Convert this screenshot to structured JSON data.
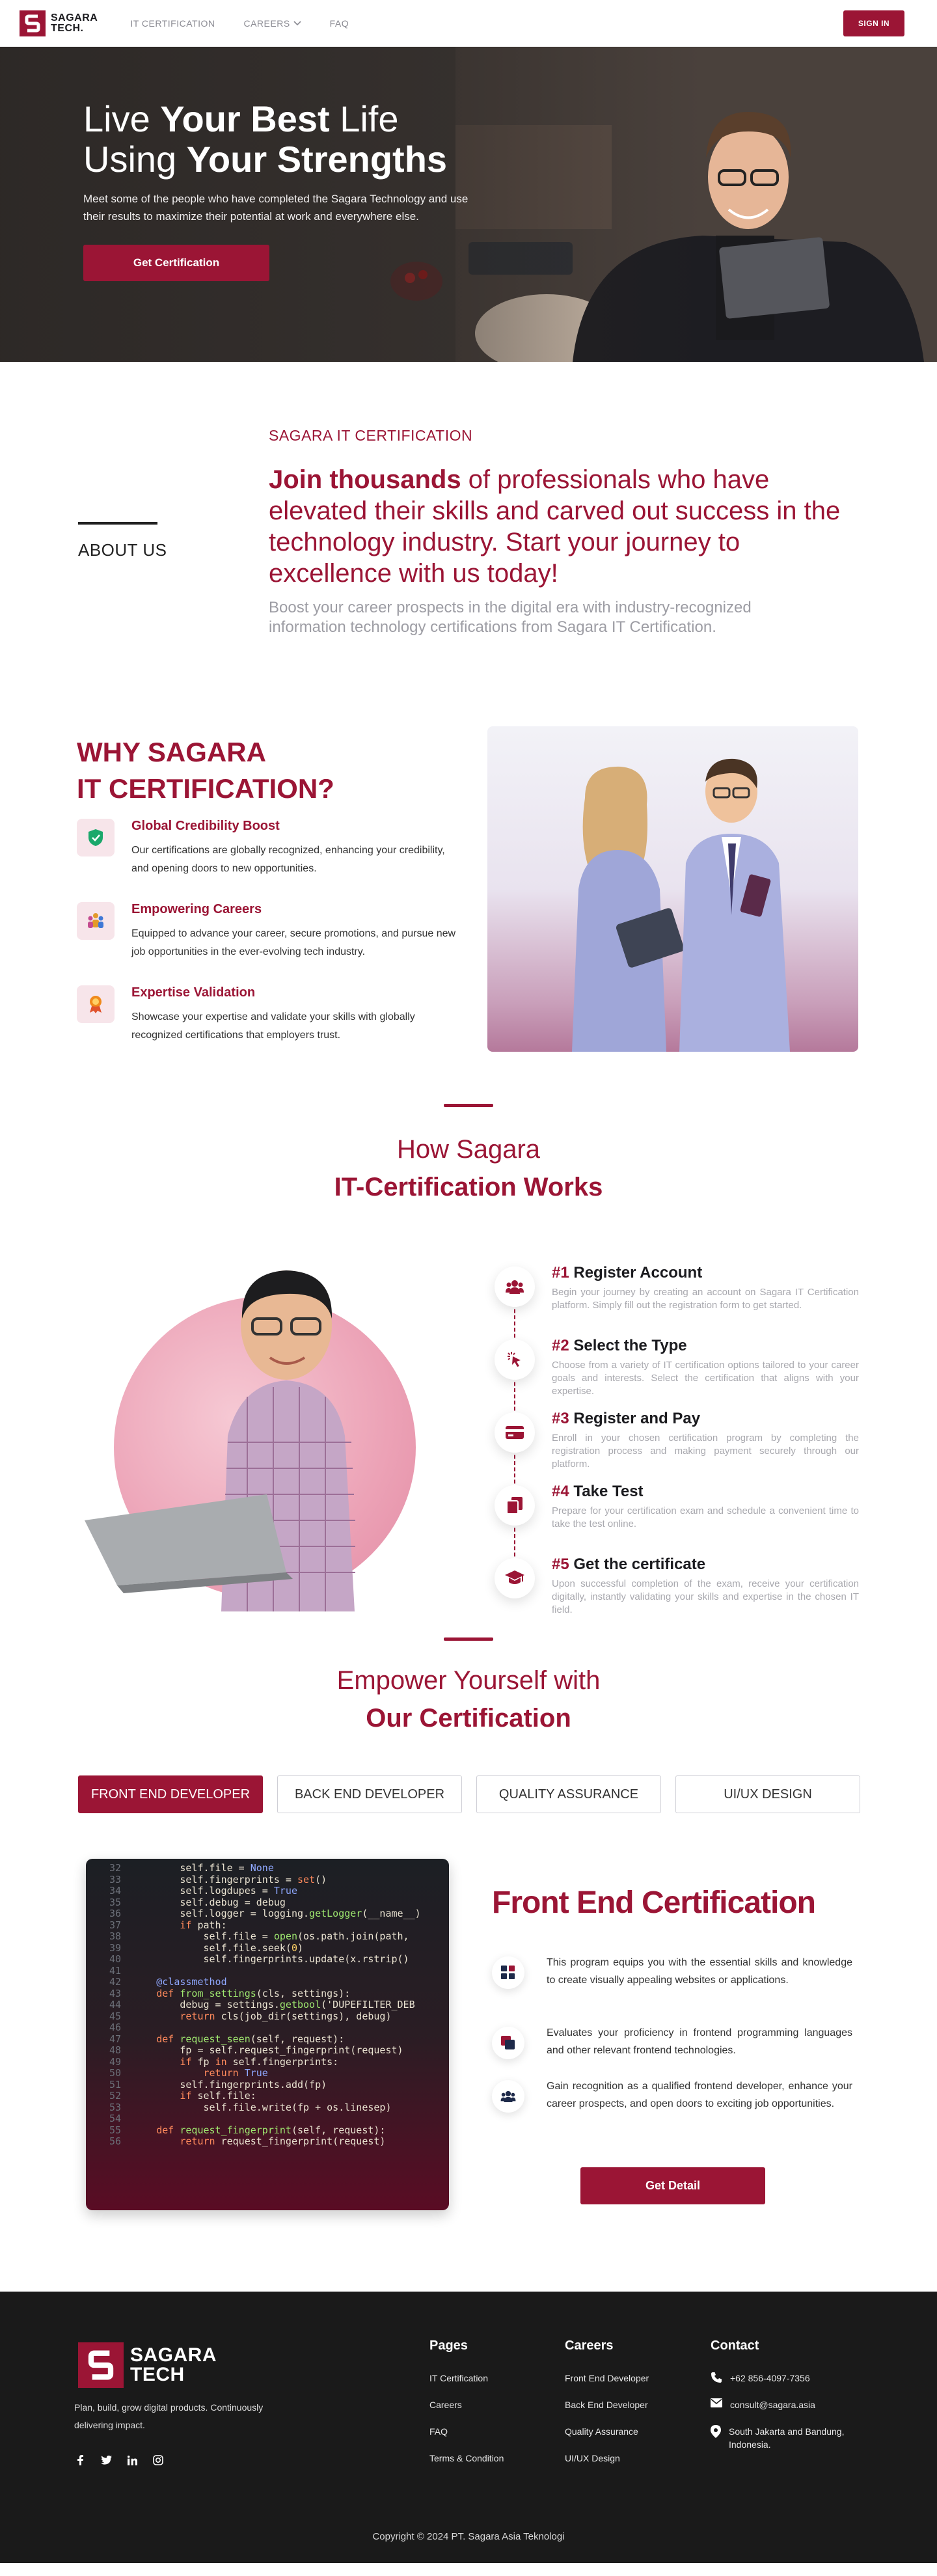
{
  "nav": {
    "logo_line1": "SAGARA",
    "logo_line2": "TECH.",
    "links": [
      "IT CERTIFICATION",
      "CAREERS",
      "FAQ"
    ],
    "signin": "SIGN IN"
  },
  "hero": {
    "title_1a": "Live ",
    "title_1b": "Your Best",
    "title_1c": " Life",
    "title_2a": "Using ",
    "title_2b": "Your Strengths",
    "subtitle": "Meet some of the people who have completed the Sagara Technology and use their results to maximize their potential at work and everywhere else.",
    "cta": "Get Certification"
  },
  "about": {
    "label": "ABOUT US",
    "kicker": "SAGARA IT CERTIFICATION",
    "head_bold": "Join thousands",
    "head_rest": " of professionals who have elevated their skills and carved out success in the technology industry. Start your journey to excellence with us today!",
    "desc": "Boost your career prospects in the digital era with industry-recognized information technology certifications from Sagara IT Certification."
  },
  "why": {
    "title_1": "WHY SAGARA",
    "title_2": "IT CERTIFICATION?",
    "items": [
      {
        "title": "Global Credibility Boost",
        "text": "Our certifications are globally recognized, enhancing your credibility, and opening doors to new opportunities."
      },
      {
        "title": "Empowering Careers",
        "text": "Equipped to advance your career, secure promotions, and pursue new job opportunities in the ever-evolving tech industry."
      },
      {
        "title": "Expertise Validation",
        "text": "Showcase your expertise and validate your skills with globally recognized certifications that employers trust."
      }
    ]
  },
  "how": {
    "title_1": "How Sagara",
    "title_2": "IT-Certification Works",
    "steps": [
      {
        "num": "#1",
        "title": " Register Account",
        "text": "Begin your journey by creating an account on Sagara IT Certification platform. Simply fill out the registration form to get started."
      },
      {
        "num": "#2",
        "title": " Select the Type",
        "text": "Choose from a variety of IT certification options tailored to your career goals and interests. Select the certification that aligns with your expertise."
      },
      {
        "num": "#3",
        "title": " Register and Pay",
        "text": "Enroll in your chosen certification program by completing the registration process and making payment securely through our platform."
      },
      {
        "num": "#4",
        "title": " Take Test",
        "text": "Prepare for your certification exam and schedule a convenient time to take the test online."
      },
      {
        "num": "#5",
        "title": " Get the certificate",
        "text": "Upon successful completion of the exam, receive your certification digitally, instantly validating your skills and expertise in the chosen IT field."
      }
    ]
  },
  "cert": {
    "title_1": "Empower Yourself with",
    "title_2": "Our Certification",
    "tabs": [
      "FRONT END DEVELOPER",
      "BACK END DEVELOPER",
      "QUALITY ASSURANCE",
      "UI/UX DESIGN"
    ],
    "active_tab": "FRONT END DEVELOPER",
    "heading": "Front End Certification",
    "items": [
      "This program equips you with the essential skills and knowledge to create visually appealing websites or applications.",
      "Evaluates your proficiency in frontend programming languages and other relevant frontend technologies.",
      "Gain recognition as a qualified frontend developer, enhance your career prospects, and open doors to exciting job opportunities."
    ],
    "cta": "Get Detail"
  },
  "footer": {
    "logo_line1": "SAGARA",
    "logo_line2": "TECH",
    "tagline": "Plan, build, grow digital products. Continuously delivering impact.",
    "pages_title": "Pages",
    "pages": [
      "IT Certification",
      "Careers",
      "FAQ",
      "Terms & Condition"
    ],
    "careers_title": "Careers",
    "careers": [
      "Front End Developer",
      "Back End Developer",
      "Quality Assurance",
      "UI/UX Design"
    ],
    "contact_title": "Contact",
    "phone": "+62 856-4097-7356",
    "email": "consult@sagara.asia",
    "address": "South Jakarta and Bandung, Indonesia.",
    "copyright": "Copyright © 2024 PT. Sagara Asia Teknologi"
  },
  "colors": {
    "brand": "#9b1535",
    "footer_bg": "#1a1a1a"
  }
}
